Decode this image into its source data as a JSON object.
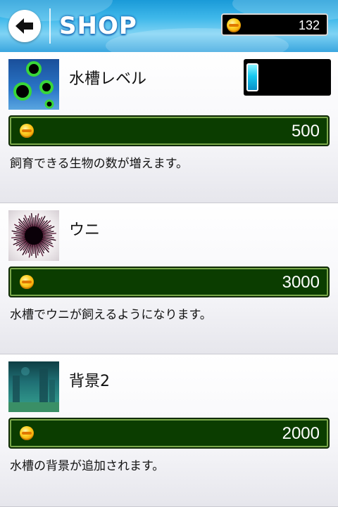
{
  "header": {
    "title": "SHOP",
    "coins": "132"
  },
  "items": [
    {
      "name": "水槽レベル",
      "price": "500",
      "description": "飼育できる生物の数が増えます。",
      "thumbnail_icon": "green-bubbles-icon",
      "level_fraction": 0.15
    },
    {
      "name": "ウニ",
      "price": "3000",
      "description": "水槽でウニが飼えるようになります。",
      "thumbnail_icon": "sea-urchin-icon"
    },
    {
      "name": "背景2",
      "price": "2000",
      "description": "水槽の背景が追加されます。",
      "thumbnail_icon": "underwater-background-icon"
    }
  ],
  "colors": {
    "header_blue": "#3fb8ea",
    "price_bar_green": "#0b3d00",
    "price_bar_border": "#7aa84a",
    "level_cyan": "#16c8f0"
  }
}
